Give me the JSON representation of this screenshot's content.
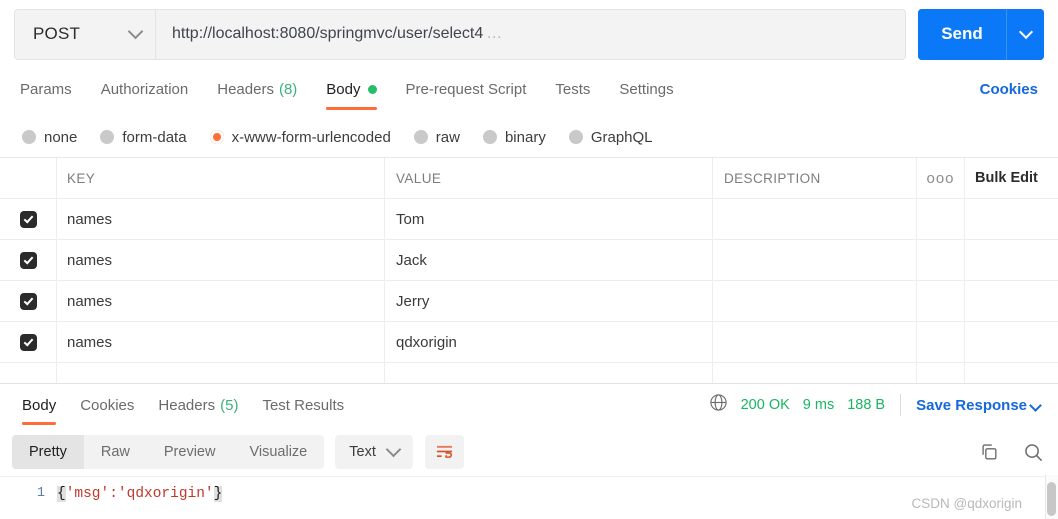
{
  "request": {
    "method": "POST",
    "method_icon": "chevron-down-icon",
    "url": "http://localhost:8080/springmvc/user/select4",
    "url_ellipsis": "…",
    "send_label": "Send",
    "send_caret_icon": "chevron-down-icon",
    "tabs": [
      {
        "label": "Params",
        "count": null,
        "active": false,
        "dot": false
      },
      {
        "label": "Authorization",
        "count": null,
        "active": false,
        "dot": false
      },
      {
        "label": "Headers",
        "count": "(8)",
        "active": false,
        "dot": false
      },
      {
        "label": "Body",
        "count": null,
        "active": true,
        "dot": true
      },
      {
        "label": "Pre-request Script",
        "count": null,
        "active": false,
        "dot": false
      },
      {
        "label": "Tests",
        "count": null,
        "active": false,
        "dot": false
      },
      {
        "label": "Settings",
        "count": null,
        "active": false,
        "dot": false
      }
    ],
    "cookies_label": "Cookies",
    "body_types": [
      {
        "label": "none",
        "selected": false
      },
      {
        "label": "form-data",
        "selected": false
      },
      {
        "label": "x-www-form-urlencoded",
        "selected": true
      },
      {
        "label": "raw",
        "selected": false
      },
      {
        "label": "binary",
        "selected": false
      },
      {
        "label": "GraphQL",
        "selected": false
      }
    ]
  },
  "params_table": {
    "headers": {
      "key": "KEY",
      "value": "VALUE",
      "description": "DESCRIPTION",
      "more_icon": "ooo",
      "bulk_edit": "Bulk Edit"
    },
    "rows": [
      {
        "checked": true,
        "key": "names",
        "value": "Tom",
        "description": ""
      },
      {
        "checked": true,
        "key": "names",
        "value": "Jack",
        "description": ""
      },
      {
        "checked": true,
        "key": "names",
        "value": "Jerry",
        "description": ""
      },
      {
        "checked": true,
        "key": "names",
        "value": "qdxorigin",
        "description": ""
      }
    ]
  },
  "response": {
    "tabs": [
      {
        "label": "Body",
        "count": null,
        "active": true
      },
      {
        "label": "Cookies",
        "count": null,
        "active": false
      },
      {
        "label": "Headers",
        "count": "(5)",
        "active": false
      },
      {
        "label": "Test Results",
        "count": null,
        "active": false
      }
    ],
    "globe_icon": "globe-icon",
    "status": "200 OK",
    "time": "9 ms",
    "size": "188 B",
    "save_response": "Save Response",
    "save_response_caret_icon": "chevron-down-icon",
    "view_modes": [
      {
        "label": "Pretty",
        "active": true
      },
      {
        "label": "Raw",
        "active": false
      },
      {
        "label": "Preview",
        "active": false
      },
      {
        "label": "Visualize",
        "active": false
      }
    ],
    "format": "Text",
    "format_caret_icon": "chevron-down-icon",
    "wrap_icon": "word-wrap-icon",
    "copy_icon": "copy-icon",
    "search_icon": "search-icon",
    "body": {
      "line_number": "1",
      "open_brace": "{",
      "content": "'msg':'qdxorigin'",
      "close_brace": "}"
    }
  },
  "watermark": "CSDN @qdxorigin",
  "colors": {
    "accent": "#ff6c37",
    "send": "#0b79f7",
    "link": "#1668dc",
    "success": "#19b562",
    "dot": "#28bd69"
  }
}
